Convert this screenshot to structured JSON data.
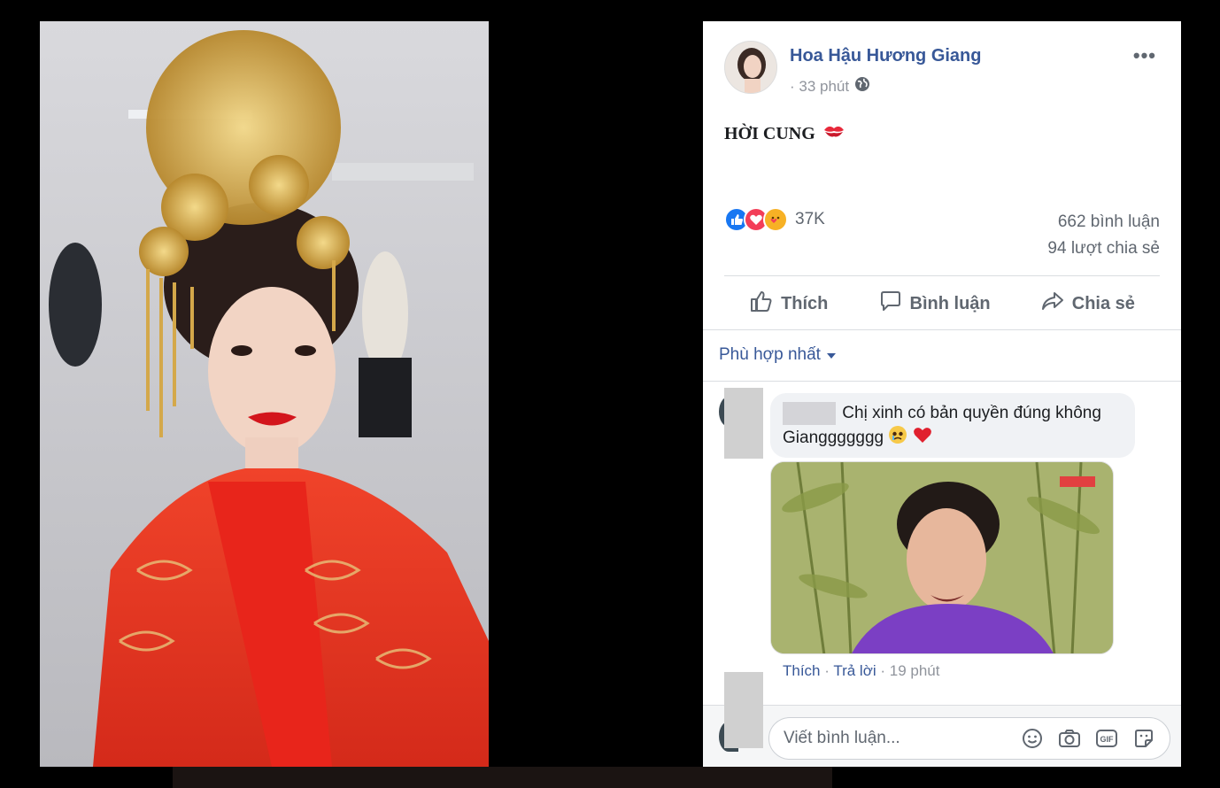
{
  "post": {
    "author": "Hoa Hậu Hương Giang",
    "time": "· 33 phút",
    "more": "•••",
    "text": "HỜI CUNG",
    "text_emoji": "kiss-mark-icon"
  },
  "reactions": {
    "count": "37K",
    "types": [
      "like",
      "love",
      "care"
    ]
  },
  "stats": {
    "comments": "662 bình luận",
    "shares": "94 lượt chia sẻ"
  },
  "actions": {
    "like": "Thích",
    "comment": "Bình luận",
    "share": "Chia sẻ"
  },
  "sort": {
    "label": "Phù hợp nhất"
  },
  "comment": {
    "text": "Chị xinh có bản quyền đúng không Gianggggggg",
    "like": "Thích",
    "reply": "Trả lời",
    "time": "19 phút"
  },
  "composer": {
    "placeholder": "Viết bình luận..."
  },
  "colors": {
    "link": "#385898",
    "muted": "#606770",
    "like_blue": "#1877f2",
    "love_red": "#f33e58",
    "care_yellow": "#f7b125"
  }
}
